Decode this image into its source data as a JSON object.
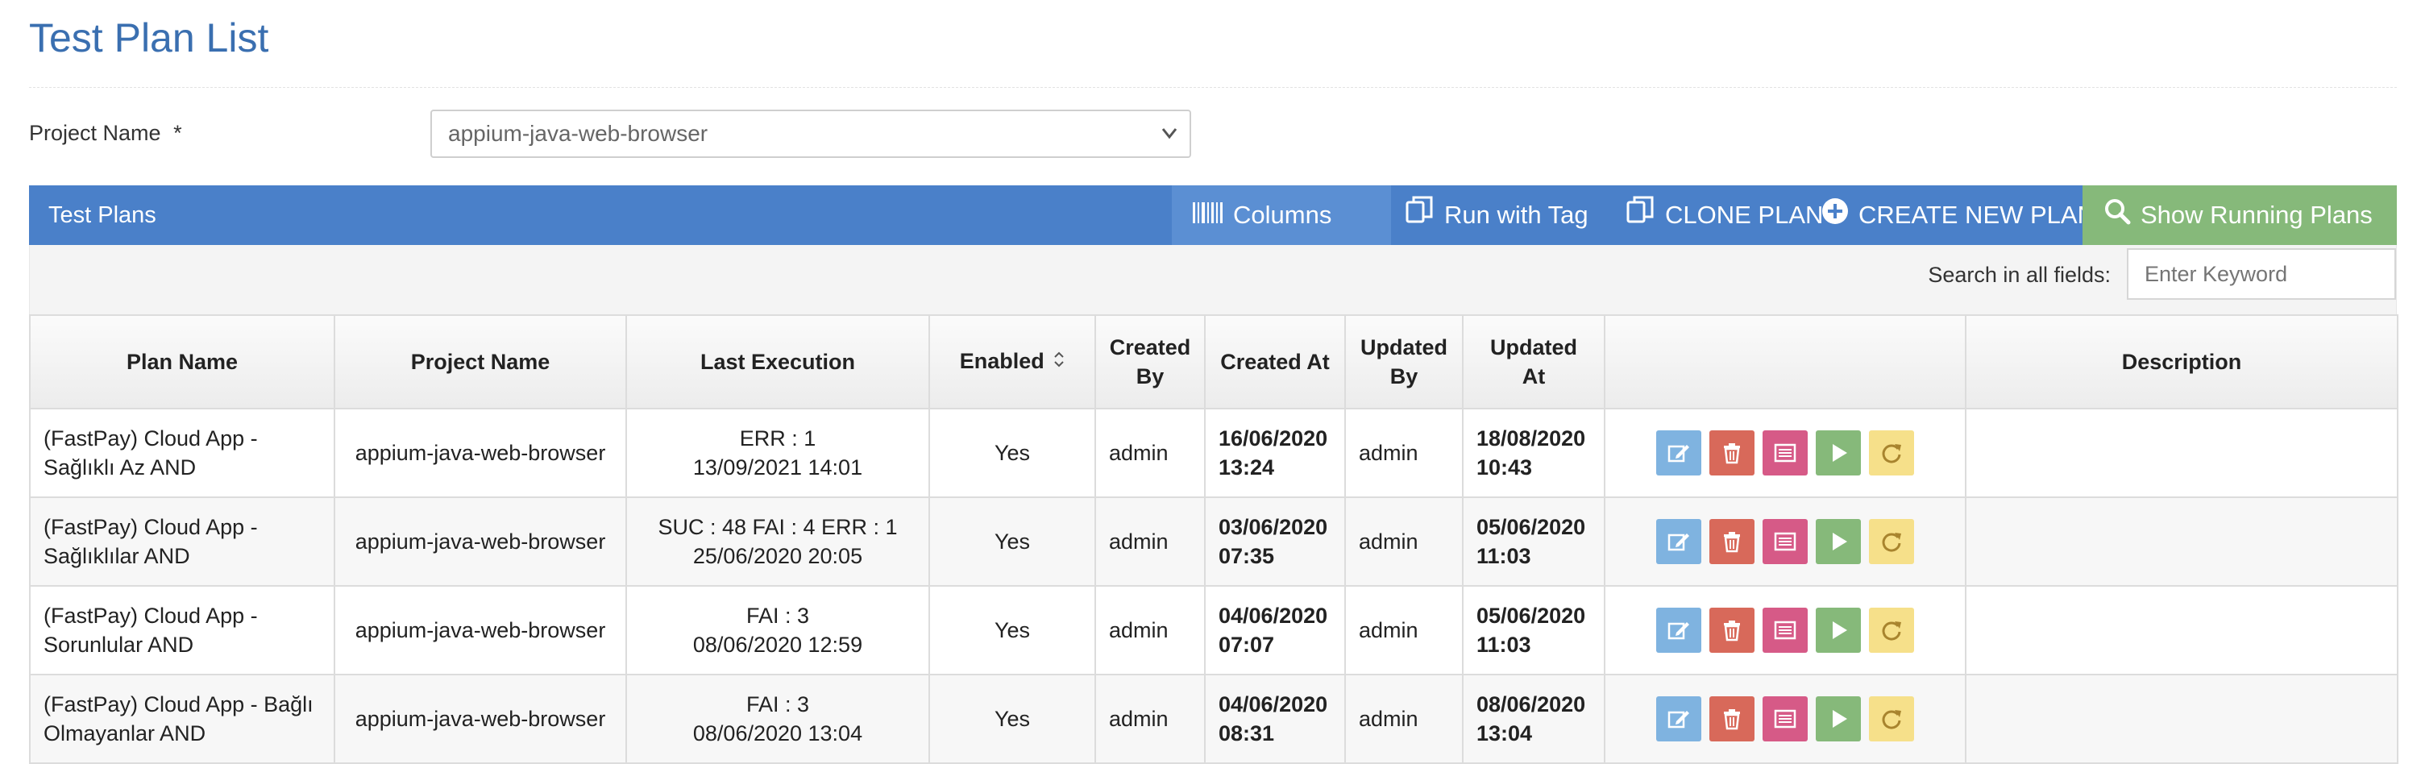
{
  "page": {
    "title": "Test Plan List"
  },
  "project": {
    "label": "Project Name",
    "required_marker": "*",
    "selected": "appium-java-web-browser"
  },
  "toolbar": {
    "panel_title": "Test Plans",
    "columns_label": "Columns",
    "run_with_tag_label": "Run with Tag",
    "clone_label": "CLONE PLAN",
    "create_label": "CREATE NEW PLAN",
    "show_running_label": "Show Running Plans"
  },
  "search": {
    "label": "Search in all fields:",
    "placeholder": "Enter Keyword"
  },
  "table": {
    "headers": {
      "plan_name": "Plan Name",
      "project_name": "Project Name",
      "last_execution": "Last Execution",
      "enabled": "Enabled",
      "created_by_1": "Created",
      "created_by_2": "By",
      "created_at": "Created At",
      "updated_by_1": "Updated",
      "updated_by_2": "By",
      "updated_at_1": "Updated",
      "updated_at_2": "At",
      "actions": "",
      "description": "Description"
    },
    "rows": [
      {
        "plan_line1": "(FastPay) Cloud App -",
        "plan_line2": "Sağlıklı Az AND",
        "project": "appium-java-web-browser",
        "exec_line1": "ERR : 1",
        "exec_line2": "13/09/2021 14:01",
        "enabled": "Yes",
        "created_by": "admin",
        "created_date": "16/06/2020",
        "created_time": "13:24",
        "updated_by": "admin",
        "updated_date": "18/08/2020",
        "updated_time": "10:43",
        "description": ""
      },
      {
        "plan_line1": "(FastPay) Cloud App -",
        "plan_line2": "Sağlıklılar AND",
        "project": "appium-java-web-browser",
        "exec_line1": "SUC : 48 FAI : 4 ERR : 1",
        "exec_line2": "25/06/2020 20:05",
        "enabled": "Yes",
        "created_by": "admin",
        "created_date": "03/06/2020",
        "created_time": "07:35",
        "updated_by": "admin",
        "updated_date": "05/06/2020",
        "updated_time": "11:03",
        "description": ""
      },
      {
        "plan_line1": "(FastPay) Cloud App -",
        "plan_line2": "Sorunlular AND",
        "project": "appium-java-web-browser",
        "exec_line1": "FAI : 3",
        "exec_line2": "08/06/2020 12:59",
        "enabled": "Yes",
        "created_by": "admin",
        "created_date": "04/06/2020",
        "created_time": "07:07",
        "updated_by": "admin",
        "updated_date": "05/06/2020",
        "updated_time": "11:03",
        "description": ""
      },
      {
        "plan_line1": "(FastPay) Cloud App - Bağlı",
        "plan_line2": "Olmayanlar AND",
        "project": "appium-java-web-browser",
        "exec_line1": "FAI : 3",
        "exec_line2": "08/06/2020 13:04",
        "enabled": "Yes",
        "created_by": "admin",
        "created_date": "04/06/2020",
        "created_time": "08:31",
        "updated_by": "admin",
        "updated_date": "08/06/2020",
        "updated_time": "13:04",
        "description": ""
      }
    ]
  },
  "colors": {
    "title": "#3a6fb0",
    "toolbar": "#4a80c9",
    "running_button": "#86b97a",
    "edit": "#7fb3e0",
    "delete": "#d8695a",
    "log": "#d65a87",
    "run": "#86b97a",
    "redo": "#f6e08a"
  },
  "icons": {
    "columns": "barcode-columns-icon",
    "run_with_tag": "copy-icon",
    "clone": "copy-icon",
    "create": "plus-circle-icon",
    "running": "search-icon",
    "row_actions": [
      "edit-icon",
      "trash-icon",
      "list-icon",
      "play-icon",
      "refresh-icon"
    ]
  }
}
